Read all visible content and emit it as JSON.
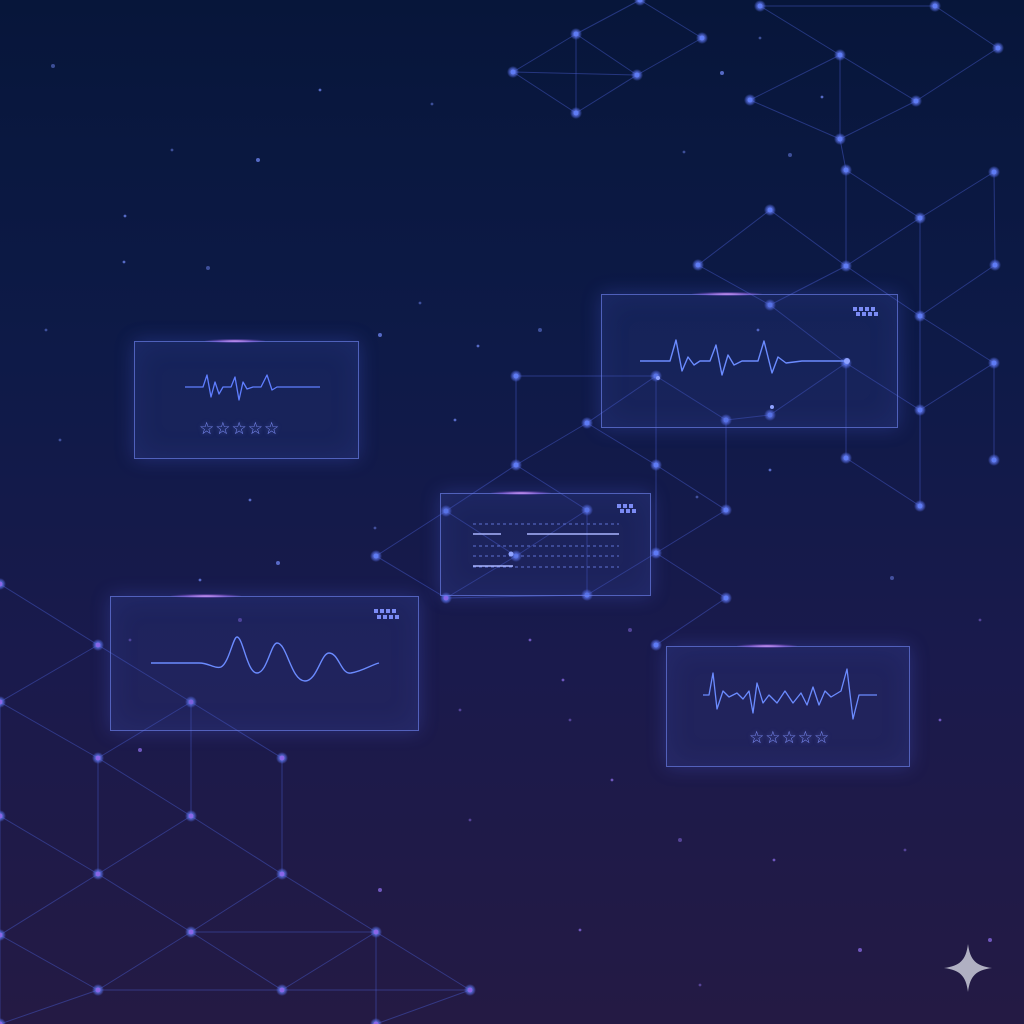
{
  "scene": {
    "background_top": "#07163a",
    "background_bottom": "#241a44",
    "network_line_color": "#4a5dd0",
    "node_color": "#5a72f0",
    "accent_glow": "#c89bff"
  },
  "panels": [
    {
      "id": "left-waveform-rating",
      "content": [
        "waveform",
        "rating"
      ],
      "rating_text": "☆☆☆☆☆",
      "rating_max": 5
    },
    {
      "id": "top-right-waveform",
      "content": [
        "waveform",
        "dot-matrix"
      ]
    },
    {
      "id": "center-text-lines",
      "content": [
        "text-lines",
        "dot-matrix"
      ]
    },
    {
      "id": "bottom-left-wave",
      "content": [
        "wave",
        "dot-matrix"
      ]
    },
    {
      "id": "bottom-right-waveform-rating",
      "content": [
        "waveform",
        "rating"
      ],
      "rating_text": "☆☆☆☆☆",
      "rating_max": 5
    }
  ],
  "icons": [
    "sparkle-icon"
  ]
}
